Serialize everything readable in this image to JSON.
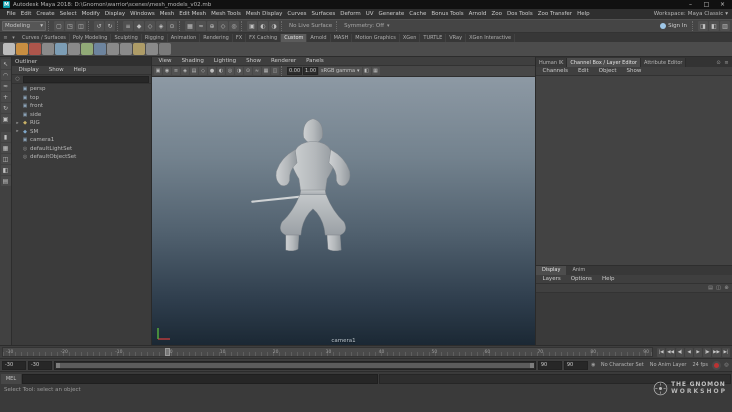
{
  "ui": {
    "arrow": "▾",
    "expand_arrow": "▸",
    "search_icon": "○"
  },
  "window": {
    "app_icon": "M",
    "title": "Autodesk Maya 2018: D:\\Gnomon\\warrior\\scenes\\mesh_models_v02.mb",
    "minimize": "–",
    "maximize": "□",
    "close": "×"
  },
  "menubar": {
    "items": [
      "File",
      "Edit",
      "Create",
      "Select",
      "Modify",
      "Display",
      "Windows",
      "Mesh",
      "Edit Mesh",
      "Mesh Tools",
      "Mesh Display",
      "Curves",
      "Surfaces",
      "Deform",
      "UV",
      "Generate",
      "Cache",
      "Bonus Tools",
      "Arnold",
      "Zoo",
      "Dos Tools",
      "Zoo Transfer",
      "Help"
    ],
    "workspace_label": "Workspace:",
    "workspace_value": "Maya Classic"
  },
  "statusline": {
    "mode": "Modeling",
    "file_icons": [
      {
        "name": "new-scene-icon",
        "glyph": "▢"
      },
      {
        "name": "open-scene-icon",
        "glyph": "◳"
      },
      {
        "name": "save-scene-icon",
        "glyph": "◫"
      }
    ],
    "undo_icons": [
      {
        "name": "undo-icon",
        "glyph": "↺"
      },
      {
        "name": "redo-icon",
        "glyph": "↻"
      }
    ],
    "selection_icons": [
      {
        "name": "select-hierarchy-icon",
        "glyph": "≡"
      },
      {
        "name": "select-object-icon",
        "glyph": "◆"
      },
      {
        "name": "select-component-icon",
        "glyph": "◇"
      },
      {
        "name": "selection-mask-icon",
        "glyph": "◈"
      },
      {
        "name": "highlight-selection-icon",
        "glyph": "⊙"
      }
    ],
    "snap_icons": [
      {
        "name": "snap-to-grid-icon",
        "glyph": "▦"
      },
      {
        "name": "snap-to-curve-icon",
        "glyph": "≈"
      },
      {
        "name": "snap-to-point-icon",
        "glyph": "⊕"
      },
      {
        "name": "snap-to-plane-icon",
        "glyph": "◇"
      },
      {
        "name": "make-live-icon",
        "glyph": "◎"
      }
    ],
    "render_icons": [
      {
        "name": "render-current-frame-icon",
        "glyph": "▣"
      },
      {
        "name": "ipr-render-icon",
        "glyph": "◐"
      },
      {
        "name": "render-settings-icon",
        "glyph": "◑"
      }
    ],
    "no_live_surface": "No Live Surface",
    "symmetry": "Symmetry: Off",
    "sign_in": "Sign In",
    "sidebar_icons": [
      {
        "name": "attribute-editor-toggle-icon",
        "glyph": "◨"
      },
      {
        "name": "tool-settings-toggle-icon",
        "glyph": "◧"
      },
      {
        "name": "channel-box-toggle-icon",
        "glyph": "▥"
      }
    ]
  },
  "shelf": {
    "left_icons": [
      {
        "name": "shelf-menu-icon",
        "glyph": "≡"
      },
      {
        "name": "shelf-tab-options-icon",
        "glyph": "▾"
      }
    ],
    "tabs": [
      {
        "label": "Curves / Surfaces"
      },
      {
        "label": "Poly Modeling"
      },
      {
        "label": "Sculpting"
      },
      {
        "label": "Rigging"
      },
      {
        "label": "Animation"
      },
      {
        "label": "Rendering"
      },
      {
        "label": "FX"
      },
      {
        "label": "FX Caching"
      },
      {
        "label": "Custom",
        "active": true
      },
      {
        "label": "Arnold"
      },
      {
        "label": "MASH"
      },
      {
        "label": "Motion Graphics"
      },
      {
        "label": "XGen"
      },
      {
        "label": "TURTLE"
      },
      {
        "label": "VRay"
      },
      {
        "label": "XGen Interactive"
      }
    ],
    "icons": [
      {
        "name": "shelf-item-1",
        "color": "#c6c6c6"
      },
      {
        "name": "shelf-item-2",
        "color": "#d29440"
      },
      {
        "name": "shelf-item-3",
        "color": "#b5564b"
      },
      {
        "name": "shelf-item-4",
        "color": "#8f8f8f"
      },
      {
        "name": "shelf-item-5",
        "color": "#80a4be"
      },
      {
        "name": "shelf-item-6",
        "color": "#8f8f8f"
      },
      {
        "name": "shelf-item-7",
        "color": "#97b27b"
      },
      {
        "name": "shelf-item-8",
        "color": "#7089a5"
      },
      {
        "name": "shelf-item-9",
        "color": "#8f8f8f"
      },
      {
        "name": "shelf-item-10",
        "color": "#8f8f8f"
      },
      {
        "name": "shelf-item-11",
        "color": "#b6a369"
      },
      {
        "name": "shelf-item-12",
        "color": "#8f8f8f"
      },
      {
        "name": "shelf-item-13",
        "color": "#7e7e7e"
      }
    ]
  },
  "toolbox": {
    "tools": [
      {
        "name": "select-tool-icon",
        "glyph": "↖"
      },
      {
        "name": "lasso-tool-icon",
        "glyph": "◠"
      },
      {
        "name": "paint-select-tool-icon",
        "glyph": "≈"
      },
      {
        "name": "move-tool-icon",
        "glyph": "+"
      },
      {
        "name": "rotate-tool-icon",
        "glyph": "↻"
      },
      {
        "name": "scale-tool-icon",
        "glyph": "▣"
      }
    ],
    "layouts": [
      {
        "name": "layout-single-pane-icon",
        "glyph": "▮"
      },
      {
        "name": "layout-four-pane-icon",
        "glyph": "▦"
      },
      {
        "name": "layout-persp-outliner-icon",
        "glyph": "◫"
      },
      {
        "name": "layout-split-icon",
        "glyph": "◧"
      },
      {
        "name": "layout-hypershade-icon",
        "glyph": "▤"
      }
    ]
  },
  "outliner": {
    "title": "Outliner",
    "menus": [
      "Display",
      "Show",
      "Help"
    ],
    "items": [
      {
        "arrow": "",
        "glyph": "▣",
        "color": "#8ba3b8",
        "label": "persp"
      },
      {
        "arrow": "",
        "glyph": "▣",
        "color": "#8ba3b8",
        "label": "top"
      },
      {
        "arrow": "",
        "glyph": "▣",
        "color": "#8ba3b8",
        "label": "front"
      },
      {
        "arrow": "",
        "glyph": "▣",
        "color": "#8ba3b8",
        "label": "side"
      },
      {
        "arrow": "▸",
        "glyph": "◆",
        "color": "#c9b267",
        "label": "RIG"
      },
      {
        "arrow": "▸",
        "glyph": "◆",
        "color": "#7fa7c9",
        "label": "SM"
      },
      {
        "arrow": "",
        "glyph": "▣",
        "color": "#8ba3b8",
        "label": "camera1"
      },
      {
        "arrow": "",
        "glyph": "◎",
        "color": "#9a9a9a",
        "label": "defaultLightSet"
      },
      {
        "arrow": "",
        "glyph": "◎",
        "color": "#9a9a9a",
        "label": "defaultObjectSet"
      }
    ]
  },
  "viewport": {
    "menus": [
      "View",
      "Shading",
      "Lighting",
      "Show",
      "Renderer",
      "Panels"
    ],
    "icons_a": [
      {
        "name": "select-camera-icon",
        "glyph": "▣"
      },
      {
        "name": "lock-camera-icon",
        "glyph": "◉"
      },
      {
        "name": "camera-attributes-icon",
        "glyph": "≡"
      },
      {
        "name": "bookmarks-icon",
        "glyph": "◈"
      },
      {
        "name": "image-plane-icon",
        "glyph": "▤"
      },
      {
        "name": "wireframe-icon",
        "glyph": "◇"
      },
      {
        "name": "shaded-icon",
        "glyph": "●"
      },
      {
        "name": "textured-icon",
        "glyph": "◐"
      },
      {
        "name": "lights-icon",
        "glyph": "◎"
      },
      {
        "name": "shadows-icon",
        "glyph": "◑"
      },
      {
        "name": "ambient-occlusion-icon",
        "glyph": "⊙"
      },
      {
        "name": "motion-blur-icon",
        "glyph": "≈"
      },
      {
        "name": "multisample-icon",
        "glyph": "▦"
      },
      {
        "name": "xray-icon",
        "glyph": "◫"
      }
    ],
    "exposure": "0.00",
    "gamma": "1.00",
    "colorspace": "sRGB gamma",
    "icons_b": [
      {
        "name": "isolate-select-icon",
        "glyph": "◧"
      },
      {
        "name": "grid-toggle-icon",
        "glyph": "▦"
      }
    ],
    "camera_label": "camera1"
  },
  "rightpanel": {
    "tabs": [
      {
        "label": "Human IK"
      },
      {
        "label": "Channel Box / Layer Editor",
        "active": true
      },
      {
        "label": "Attribute Editor"
      }
    ],
    "corner_icons": [
      {
        "name": "pin-icon",
        "glyph": "⊙"
      },
      {
        "name": "panel-menu-icon",
        "glyph": "≡"
      }
    ],
    "channel_menus": [
      "Channels",
      "Edit",
      "Object",
      "Show"
    ],
    "layer_tabs": [
      {
        "label": "Display",
        "active": true
      },
      {
        "label": "Anim"
      }
    ],
    "layer_menus": [
      "Layers",
      "Options",
      "Help"
    ],
    "layer_icons": [
      {
        "name": "new-empty-layer-icon",
        "glyph": "▤"
      },
      {
        "name": "new-layer-from-selected-icon",
        "glyph": "◫"
      },
      {
        "name": "add-selection-to-layer-icon",
        "glyph": "⊕"
      }
    ]
  },
  "timeline": {
    "labels": [
      "-30",
      "-20",
      "-10",
      "0",
      "10",
      "20",
      "30",
      "40",
      "50",
      "60",
      "70",
      "80",
      "90"
    ],
    "playback": [
      {
        "name": "go-to-start-button",
        "glyph": "|◀"
      },
      {
        "name": "step-back-frame-button",
        "glyph": "◀◀"
      },
      {
        "name": "step-back-key-button",
        "glyph": "◀|"
      },
      {
        "name": "play-backwards-button",
        "glyph": "◀"
      },
      {
        "name": "play-forwards-button",
        "glyph": "▶"
      },
      {
        "name": "step-forward-key-button",
        "glyph": "|▶"
      },
      {
        "name": "step-forward-frame-button",
        "glyph": "▶▶"
      },
      {
        "name": "go-to-end-button",
        "glyph": "▶|"
      }
    ]
  },
  "rangeslider": {
    "anim_start": "-30",
    "play_start": "-30",
    "play_end": "90",
    "anim_end": "90",
    "character_set": "No Character Set",
    "anim_layer": "No Anim Layer",
    "fps": "24 fps"
  },
  "commandline": {
    "label": "MEL",
    "value": ""
  },
  "helpline": {
    "text": "Select Tool: select an object"
  },
  "gnomon": {
    "line1": "THE GNOMON",
    "line2": "WORKSHOP"
  }
}
